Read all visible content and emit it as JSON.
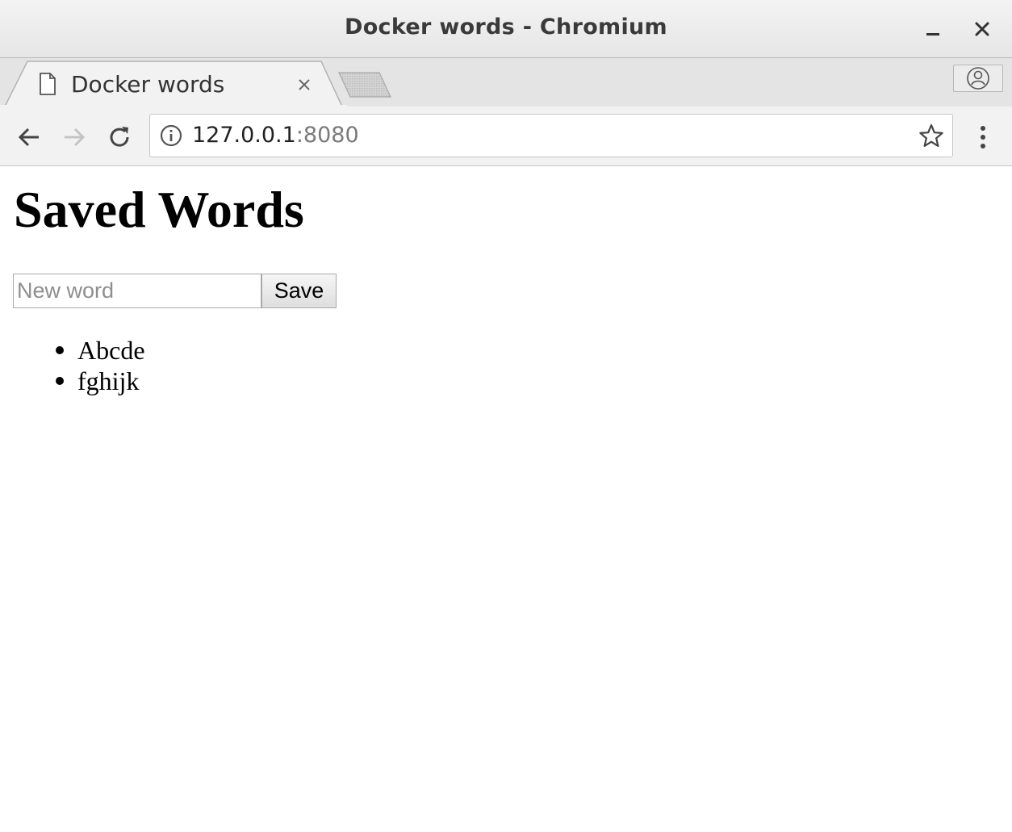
{
  "window": {
    "title": "Docker words - Chromium"
  },
  "tabs": [
    {
      "title": "Docker words",
      "active": true
    }
  ],
  "toolbar": {
    "url_host": "127.0.0.1",
    "url_port": ":8080"
  },
  "page": {
    "heading": "Saved Words",
    "input_placeholder": "New word",
    "input_value": "",
    "save_label": "Save",
    "words": [
      "Abcde",
      "fghijk"
    ]
  },
  "icons": {
    "minimize": "minimize-icon",
    "close": "close-icon",
    "tab_document": "document-icon",
    "tab_close": "tab-close-icon",
    "new_tab": "new-tab-icon",
    "profile": "profile-icon",
    "back": "back-arrow-icon",
    "forward": "forward-arrow-icon",
    "reload": "reload-icon",
    "site_info": "info-icon",
    "bookmark": "star-icon",
    "menu": "kebab-menu-icon"
  },
  "colors": {
    "titlebar": "#e9e9e9",
    "tabstrip": "#e4e4e4",
    "toolbar": "#f2f2f2",
    "url_port": "#7a7a7a"
  }
}
